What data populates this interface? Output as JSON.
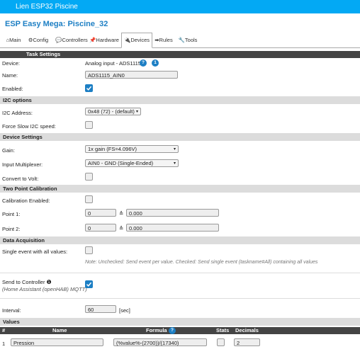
{
  "window": {
    "title": "Lien ESP32 Piscine"
  },
  "brand": "ESP Easy Mega: Piscine_32",
  "tabs": [
    {
      "icon": "⌂",
      "label": "Main"
    },
    {
      "icon": "⚙",
      "label": "Config"
    },
    {
      "icon": "💬",
      "label": "Controllers"
    },
    {
      "icon": "📌",
      "label": "Hardware"
    },
    {
      "icon": "🔌",
      "label": "Devices"
    },
    {
      "icon": "➡",
      "label": "Rules"
    },
    {
      "icon": "🔧",
      "label": "Tools"
    }
  ],
  "task_settings": {
    "header": "Task Settings",
    "device_label": "Device:",
    "device_value": "Analog input - ADS1115",
    "help_badge": "?",
    "info_badge": "1",
    "name_label": "Name:",
    "name_value": "ADS1115_AIN0",
    "enabled_label": "Enabled:"
  },
  "i2c": {
    "header": "I2C options",
    "address_label": "I2C Address:",
    "address_value": "0x48 (72) - (default)",
    "force_slow_label": "Force Slow I2C speed:"
  },
  "device_settings": {
    "header": "Device Settings",
    "gain_label": "Gain:",
    "gain_value": "1x gain (FS=4.096V)",
    "multiplexer_label": "Input Multiplexer:",
    "multiplexer_value": "AIN0 - GND (Single-Ended)",
    "convert_label": "Convert to Volt:"
  },
  "calibration": {
    "header": "Two Point Calibration",
    "enabled_label": "Calibration Enabled:",
    "point1_label": "Point 1:",
    "point1_adc": "0",
    "point1_arrow": "≙",
    "point1_value": "0.000",
    "point2_label": "Point 2:",
    "point2_adc": "0",
    "point2_arrow": "≙",
    "point2_value": "0.000"
  },
  "data_acquisition": {
    "header": "Data Acquisition",
    "single_event_label": "Single event with all values:",
    "note": "Note: Unchecked: Send event per value. Checked: Send single event (taskname#All) containing all values",
    "send_label": "Send to Controller",
    "send_info_icon": "❶",
    "send_sub": "(Home Assistant (openHAB) MQTT)",
    "interval_label": "Interval:",
    "interval_value": "60",
    "interval_unit": "[sec]"
  },
  "values": {
    "header": "Values",
    "columns": {
      "num": "#",
      "name": "Name",
      "formula": "Formula",
      "formula_help": "?",
      "stats": "Stats",
      "decimals": "Decimals"
    },
    "rows": [
      {
        "num": "1",
        "name": "Pression",
        "formula": "(%value%-(2700))/(17340)",
        "decimals": "2"
      }
    ]
  },
  "colors": {
    "topbar": "#03a9f4",
    "accent": "#1d7fc4",
    "section": "#dcdcdc",
    "table_header": "#444444"
  }
}
